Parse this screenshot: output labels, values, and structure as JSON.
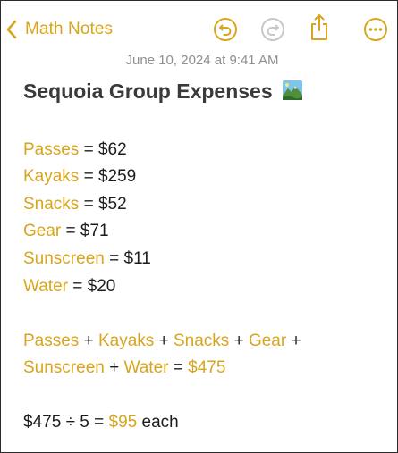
{
  "navbar": {
    "back_label": "Math Notes",
    "icons": {
      "back": "chevron-left-icon",
      "undo": "undo-icon",
      "redo": "redo-icon",
      "share": "share-icon",
      "more": "more-icon"
    }
  },
  "timestamp": "June 10, 2024 at 9:41 AM",
  "note": {
    "title": "Sequoia Group Expenses",
    "title_emoji": "mountain-landscape-emoji",
    "items": [
      {
        "name": "Passes",
        "eq": "=",
        "value": "$62"
      },
      {
        "name": "Kayaks",
        "eq": "=",
        "value": "$259"
      },
      {
        "name": "Snacks",
        "eq": "=",
        "value": "$52"
      },
      {
        "name": "Gear",
        "eq": "=",
        "value": "$71"
      },
      {
        "name": "Sunscreen",
        "eq": "=",
        "value": "$11"
      },
      {
        "name": "Water",
        "eq": "=",
        "value": "$20"
      }
    ],
    "sum_expression": {
      "line1": {
        "t1": "Passes",
        "p1": "+",
        "t2": "Kayaks",
        "p2": "+",
        "t3": "Snacks",
        "p3": "+",
        "t4": "Gear",
        "p4": "+"
      },
      "line2": {
        "t5": "Sunscreen",
        "p5": "+",
        "t6": "Water",
        "eq": "=",
        "result": "$475"
      }
    },
    "split_expression": {
      "dividend": "$475",
      "operator": "÷",
      "divisor": "5",
      "eq": "=",
      "result": "$95",
      "suffix": "each"
    }
  },
  "colors": {
    "accent": "#d8a51c",
    "text": "#1c1c1e",
    "secondary_text": "#8e8e93",
    "icon_disabled": "#c7c7cc"
  }
}
